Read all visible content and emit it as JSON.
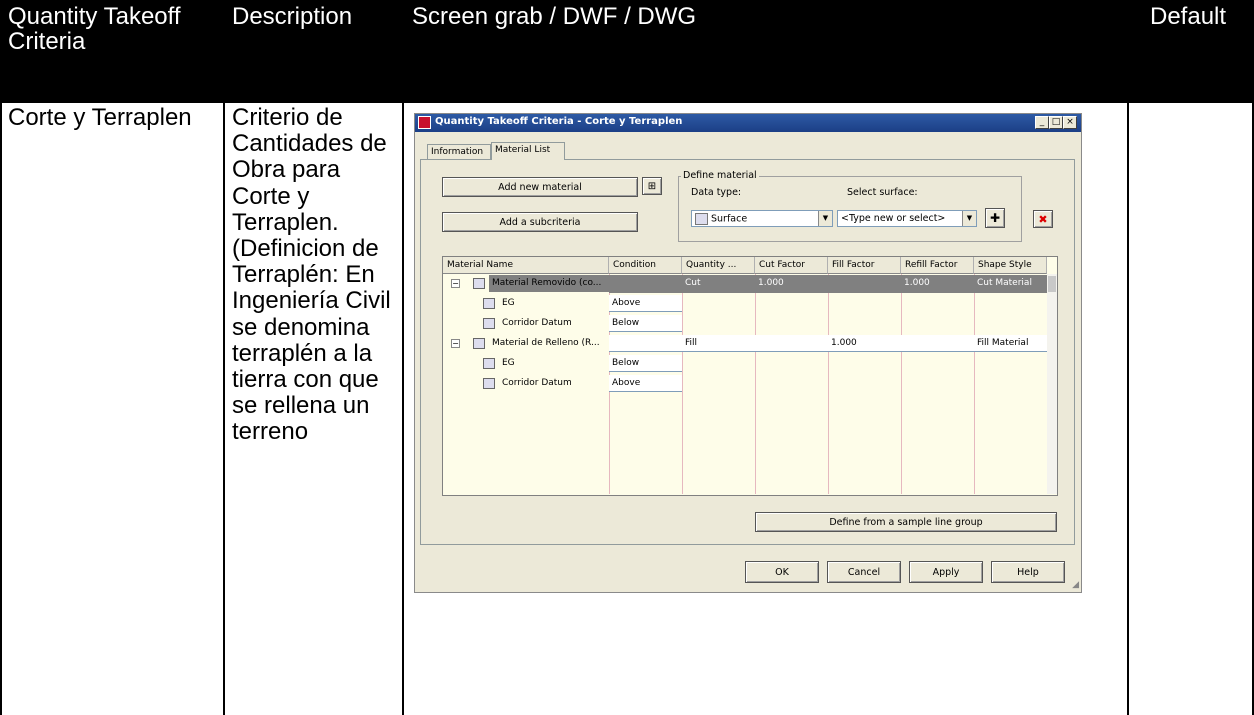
{
  "table": {
    "headers": [
      "Quantity Takeoff Criteria",
      "Description",
      "Screen grab / DWF / DWG",
      "Default"
    ],
    "row": {
      "criteria": "Corte y Terraplen",
      "description": "Criterio de Cantidades de Obra para Corte y Terraplen. (Definicion de Terraplén: En Ingeniería Civil se denomina terraplén a la tierra con que se rellena un terreno"
    }
  },
  "colors": {
    "header_bg": "#000000",
    "header_text": "#ffffff",
    "title_bar": "#1c3f86",
    "selected_row": "#808080",
    "grid_bg": "#fefde9"
  },
  "dialog": {
    "title": "Quantity Takeoff Criteria - Corte y Terraplen",
    "window_buttons": [
      "_",
      "□",
      "×"
    ],
    "tabs": [
      "Information",
      "Material List"
    ],
    "add_material_button": "Add new material",
    "pick_icon": "pick-from-drawing-icon",
    "add_subcriteria_button": "Add a subcriteria",
    "define_group": {
      "title": "Define material",
      "data_type_label": "Data type:",
      "data_type_value": "Surface",
      "surface_label": "Select surface:",
      "surface_value": "<Type new or select>",
      "add_icon": "add-icon",
      "delete_icon": "delete-icon"
    },
    "grid": {
      "columns": [
        "Material Name",
        "Condition",
        "Quantity ...",
        "Cut Factor",
        "Fill Factor",
        "Refill Factor",
        "Shape Style"
      ],
      "rows": [
        {
          "name": "Material Removido (co...",
          "condition": "",
          "quantity": "Cut",
          "cut": "1.000",
          "fill": "",
          "refill": "1.000",
          "style": "Cut Material",
          "level": 0,
          "expander": "⊟"
        },
        {
          "name": "EG",
          "condition": "Above",
          "quantity": "",
          "cut": "",
          "fill": "",
          "refill": "",
          "style": "",
          "level": 1,
          "expander": ""
        },
        {
          "name": "Corridor Datum",
          "condition": "Below",
          "quantity": "",
          "cut": "",
          "fill": "",
          "refill": "",
          "style": "",
          "level": 1,
          "expander": ""
        },
        {
          "name": "Material de Relleno (R...",
          "condition": "",
          "quantity": "Fill",
          "cut": "",
          "fill": "1.000",
          "refill": "",
          "style": "Fill Material",
          "level": 0,
          "expander": "⊟"
        },
        {
          "name": "EG",
          "condition": "Below",
          "quantity": "",
          "cut": "",
          "fill": "",
          "refill": "",
          "style": "",
          "level": 1,
          "expander": ""
        },
        {
          "name": "Corridor Datum",
          "condition": "Above",
          "quantity": "",
          "cut": "",
          "fill": "",
          "refill": "",
          "style": "",
          "level": 1,
          "expander": ""
        }
      ]
    },
    "sample_line_button": "Define from a sample line group",
    "buttons": {
      "ok": "OK",
      "cancel": "Cancel",
      "apply": "Apply",
      "help": "Help"
    }
  }
}
